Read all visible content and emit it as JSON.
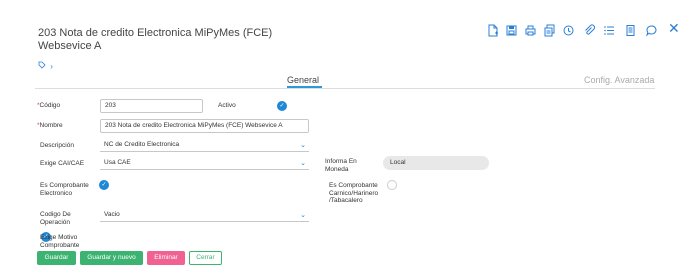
{
  "header": {
    "title": "203 Nota de credito Electronica MiPyMes (FCE) Websevice A",
    "toolbar_icons": [
      "new-document-icon",
      "save-icon",
      "print-icon",
      "copy-icon",
      "history-icon",
      "attach-icon",
      "list-icon",
      "document-icon",
      "comment-icon",
      "close-icon"
    ],
    "close_glyph": "✕"
  },
  "subbar": {
    "tag_icon": "tag-icon",
    "chevron": "›"
  },
  "tabs": {
    "general": "General",
    "advanced": "Config. Avanzada"
  },
  "form": {
    "codigo": {
      "label": "Código",
      "value": "203"
    },
    "activo": {
      "label": "Activo",
      "checked": true
    },
    "nombre": {
      "label": "Nombre",
      "value": "203 Nota de credito Electronica MiPyMes (FCE) Websevice A"
    },
    "descripcion": {
      "label": "Descripción",
      "value": "NC de Credito Electronica"
    },
    "exige_cai": {
      "label": "Exige CAI/CAE",
      "value": "Usa CAE"
    },
    "informa_moneda": {
      "label": "Informa En Moneda",
      "value": "Local"
    },
    "es_comprobante_electronico": {
      "label": "Es Comprobante Electronico",
      "checked": true
    },
    "es_comprobante_carnico": {
      "label": "Es Comprobante Carnico/Harinero /Tabacalero",
      "checked": false
    },
    "codigo_operacion": {
      "label": "Codigo De Operación",
      "value": "Vacio"
    },
    "exige_motivo": {
      "label": "Exige Motivo Comprobante",
      "checked": true
    }
  },
  "buttons": {
    "save": "Guardar",
    "save_new": "Guardar y nuevo",
    "delete": "Eliminar",
    "cancel": "Cerrar"
  },
  "colors": {
    "accent": "#2a7fd4",
    "save": "#3cb371",
    "delete": "#f06292"
  }
}
